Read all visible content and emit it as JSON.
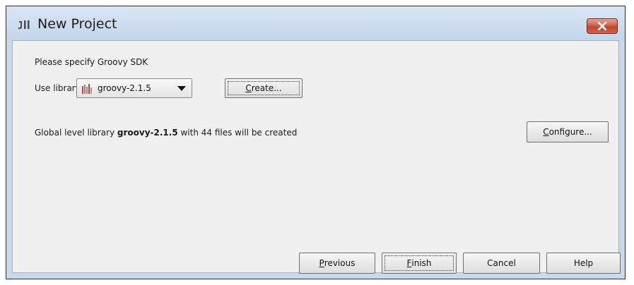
{
  "window": {
    "title": "New Project",
    "icons": {
      "app": "intellij-app-icon",
      "close": "close-icon"
    }
  },
  "sdk": {
    "heading": "Please specify Groovy SDK",
    "use_library_label": "Use library",
    "library_dropdown": {
      "selected": "groovy-2.1.5",
      "icon": "library-icon"
    },
    "create_button": {
      "mnemonic": "C",
      "rest": "reate..."
    }
  },
  "info": {
    "prefix": "Global level library ",
    "library_name": "groovy-2.1.5",
    "suffix": " with 44 files will be created"
  },
  "configure_button": {
    "mnemonic": "C",
    "rest": "onfigure..."
  },
  "footer": {
    "previous": {
      "mnemonic": "P",
      "rest": "revious"
    },
    "finish": {
      "mnemonic": "F",
      "rest": "inish"
    },
    "cancel": "Cancel",
    "help": "Help"
  },
  "colors": {
    "title_bar": "#c9d8ea",
    "dialog_background": "#f0f0f0",
    "close_button": "#c7503a"
  }
}
